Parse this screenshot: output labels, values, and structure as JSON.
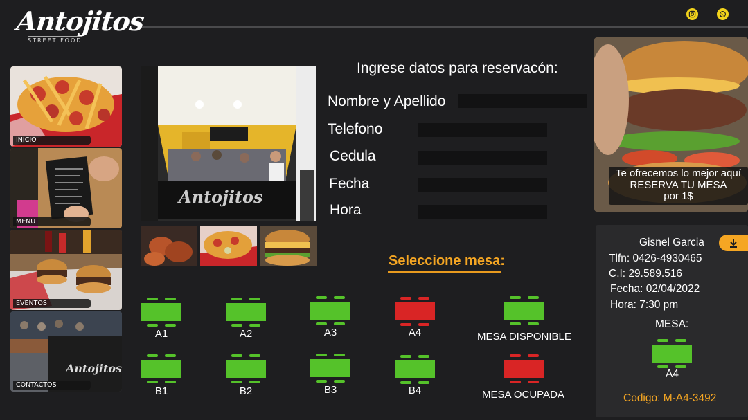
{
  "brand": {
    "name": "Antojitos",
    "tagline": "STREET FOOD"
  },
  "social": {
    "instagram": "instagram-icon",
    "whatsapp": "whatsapp-icon"
  },
  "nav": [
    {
      "label": "INICIO"
    },
    {
      "label": "MENU"
    },
    {
      "label": "EVENTOS"
    },
    {
      "label": "CONTACTOS"
    }
  ],
  "form": {
    "title": "Ingrese datos para reservacón:",
    "fields": [
      {
        "label": "Nombre y Apellido",
        "value": ""
      },
      {
        "label": "Telefono",
        "value": ""
      },
      {
        "label": "Cedula",
        "value": ""
      },
      {
        "label": "Fecha",
        "value": ""
      },
      {
        "label": "Hora",
        "value": ""
      }
    ]
  },
  "tables": {
    "title": "Seleccione mesa:",
    "row_a": [
      {
        "id": "A1",
        "status": "disponible"
      },
      {
        "id": "A2",
        "status": "disponible"
      },
      {
        "id": "A3",
        "status": "disponible"
      },
      {
        "id": "A4",
        "status": "ocupada"
      }
    ],
    "row_b": [
      {
        "id": "B1",
        "status": "disponible"
      },
      {
        "id": "B2",
        "status": "disponible"
      },
      {
        "id": "B3",
        "status": "disponible"
      },
      {
        "id": "B4",
        "status": "disponible"
      }
    ],
    "legend": {
      "available": "MESA DISPONIBLE",
      "occupied": "MESA OCUPADA"
    }
  },
  "promo": {
    "line1": "Te ofrecemos lo mejor aquí",
    "line2": "RESERVA TU MESA",
    "line3": "por 1$"
  },
  "summary": {
    "name": "Gisnel Garcia",
    "phone": "Tlfn: 0426-4930465",
    "ci": "C.I: 29.589.516",
    "date": "Fecha: 02/04/2022",
    "time": "Hora: 7:30 pm",
    "table_label": "MESA:",
    "table_id": "A4",
    "code": "Codigo: M-A4-3492"
  },
  "colors": {
    "accent": "#f5a623",
    "available": "#55c22a",
    "occupied": "#d92525",
    "background": "#1e1e20"
  }
}
